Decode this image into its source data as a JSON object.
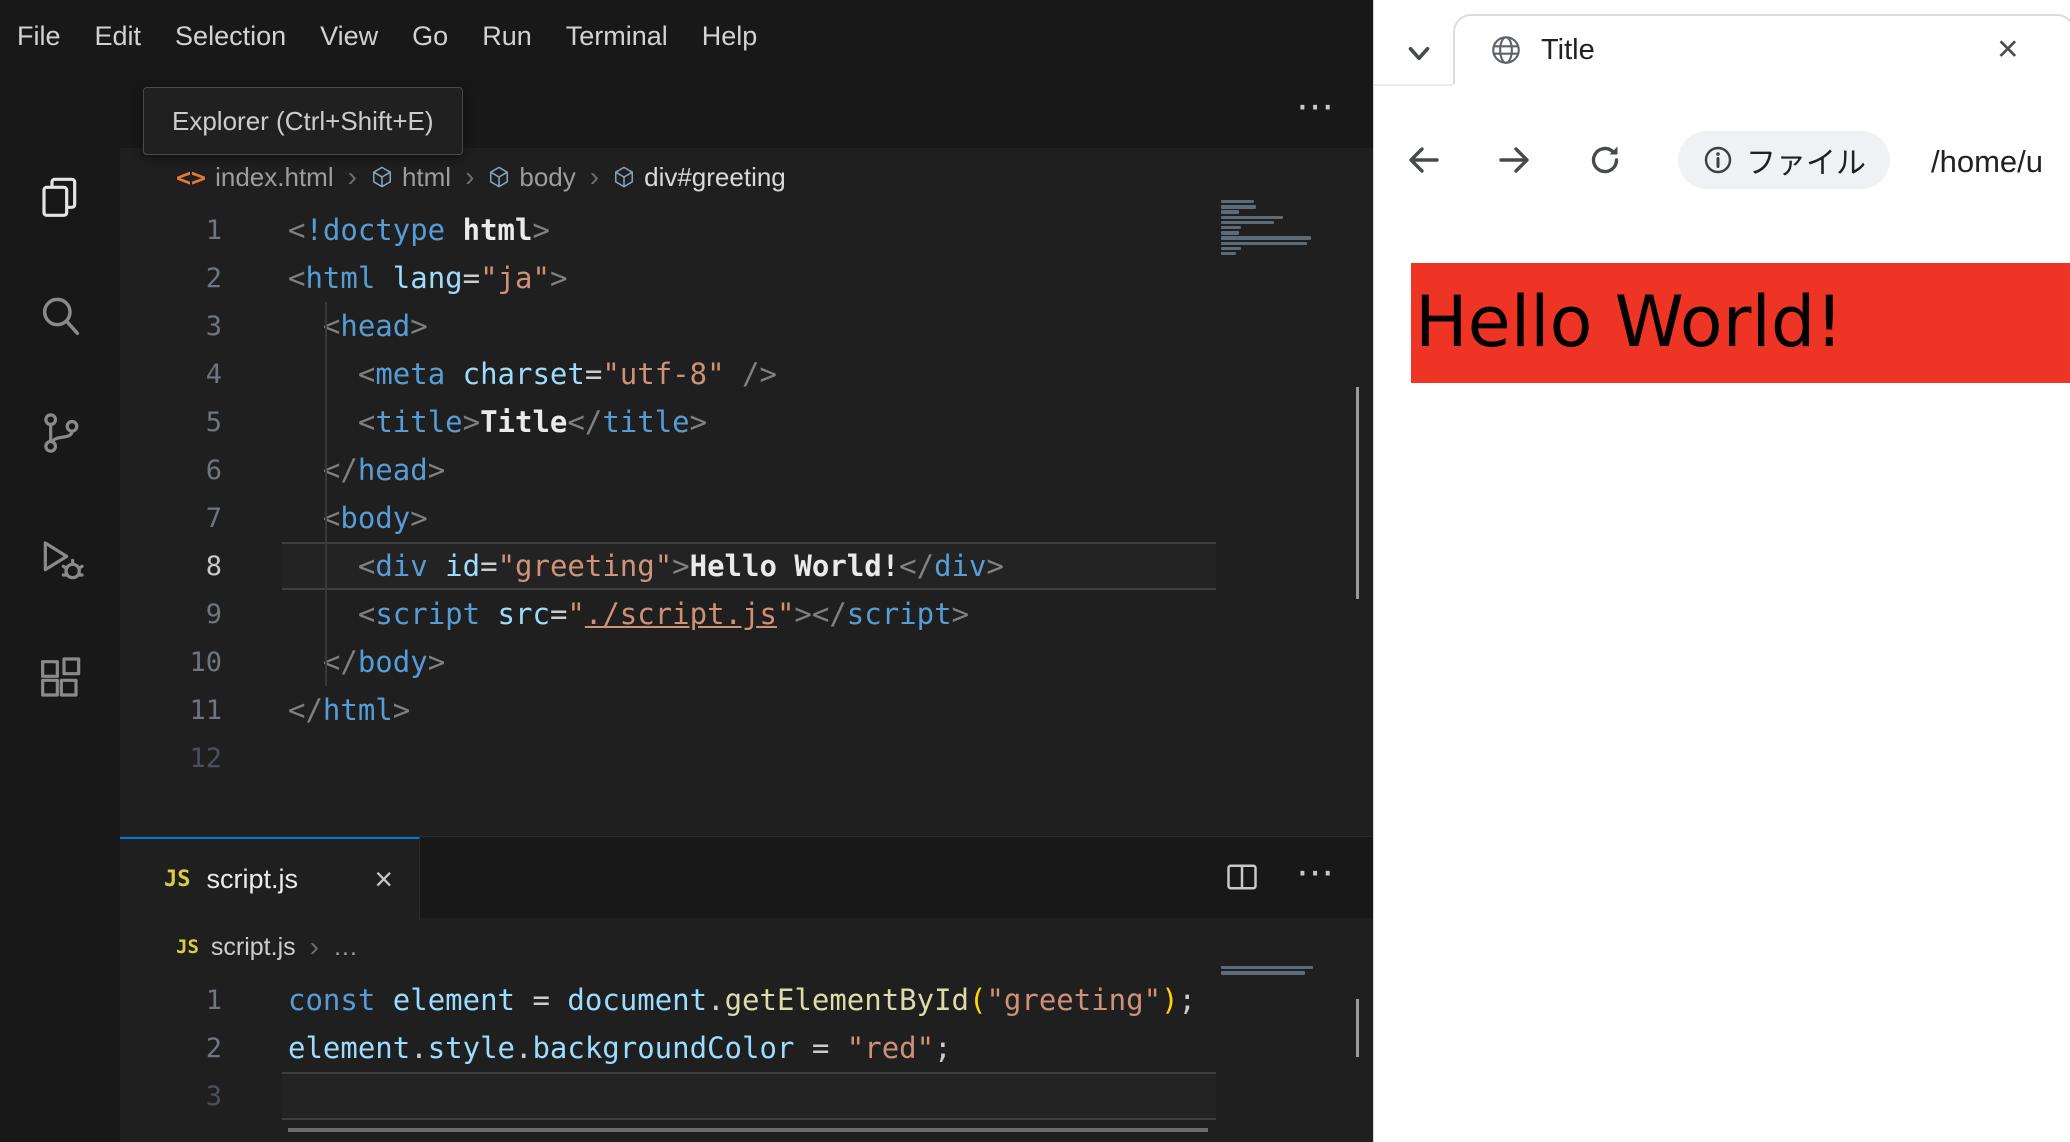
{
  "vscode": {
    "menu": [
      "File",
      "Edit",
      "Selection",
      "View",
      "Go",
      "Run",
      "Terminal",
      "Help"
    ],
    "tooltip": "Explorer (Ctrl+Shift+E)",
    "activity_icons": [
      "explorer",
      "search",
      "source-control",
      "run-debug",
      "extensions"
    ],
    "icons": {
      "html_file": "<>"
    },
    "more_glyph": "⋯",
    "breadcrumb": {
      "file": "index.html",
      "path": [
        "html",
        "body",
        "div#greeting"
      ],
      "separator": "›"
    },
    "editor_top": {
      "current_line": 8,
      "lines": [
        {
          "tokens": [
            [
              "<",
              "pun"
            ],
            [
              "!doctype",
              "tag"
            ],
            [
              " ",
              "txt"
            ],
            [
              "html",
              "txtb"
            ],
            [
              ">",
              "pun"
            ]
          ]
        },
        {
          "tokens": [
            [
              "<",
              "pun"
            ],
            [
              "html",
              "tag"
            ],
            [
              " ",
              "txt"
            ],
            [
              "lang",
              "attr"
            ],
            [
              "=",
              "txt"
            ],
            [
              "\"ja\"",
              "str"
            ],
            [
              ">",
              "pun"
            ]
          ]
        },
        {
          "tokens": [
            [
              "  ",
              "txt"
            ],
            [
              "<",
              "pun"
            ],
            [
              "head",
              "tag"
            ],
            [
              ">",
              "pun"
            ]
          ]
        },
        {
          "tokens": [
            [
              "    ",
              "txt"
            ],
            [
              "<",
              "pun"
            ],
            [
              "meta",
              "tag"
            ],
            [
              " ",
              "txt"
            ],
            [
              "charset",
              "attr"
            ],
            [
              "=",
              "txt"
            ],
            [
              "\"utf-8\"",
              "str"
            ],
            [
              " ",
              "txt"
            ],
            [
              "/>",
              "pun"
            ]
          ]
        },
        {
          "tokens": [
            [
              "    ",
              "txt"
            ],
            [
              "<",
              "pun"
            ],
            [
              "title",
              "tag"
            ],
            [
              ">",
              "pun"
            ],
            [
              "Title",
              "txtb"
            ],
            [
              "</",
              "pun"
            ],
            [
              "title",
              "tag"
            ],
            [
              ">",
              "pun"
            ]
          ]
        },
        {
          "tokens": [
            [
              "  ",
              "txt"
            ],
            [
              "</",
              "pun"
            ],
            [
              "head",
              "tag"
            ],
            [
              ">",
              "pun"
            ]
          ]
        },
        {
          "tokens": [
            [
              "  ",
              "txt"
            ],
            [
              "<",
              "pun"
            ],
            [
              "body",
              "tag"
            ],
            [
              ">",
              "pun"
            ]
          ]
        },
        {
          "tokens": [
            [
              "    ",
              "txt"
            ],
            [
              "<",
              "pun"
            ],
            [
              "div",
              "tag"
            ],
            [
              " ",
              "txt"
            ],
            [
              "id",
              "attr"
            ],
            [
              "=",
              "txt"
            ],
            [
              "\"greeting\"",
              "str"
            ],
            [
              ">",
              "pun"
            ],
            [
              "Hello World!",
              "txtb"
            ],
            [
              "</",
              "pun"
            ],
            [
              "div",
              "tag"
            ],
            [
              ">",
              "pun"
            ]
          ]
        },
        {
          "tokens": [
            [
              "    ",
              "txt"
            ],
            [
              "<",
              "pun"
            ],
            [
              "script",
              "tag"
            ],
            [
              " ",
              "txt"
            ],
            [
              "src",
              "attr"
            ],
            [
              "=",
              "txt"
            ],
            [
              "\"",
              "str"
            ],
            [
              "./script.js",
              "strlink"
            ],
            [
              "\"",
              "str"
            ],
            [
              ">",
              "pun"
            ],
            [
              "</",
              "pun"
            ],
            [
              "script",
              "tag"
            ],
            [
              ">",
              "pun"
            ]
          ]
        },
        {
          "tokens": [
            [
              "  ",
              "txt"
            ],
            [
              "</",
              "pun"
            ],
            [
              "body",
              "tag"
            ],
            [
              ">",
              "pun"
            ]
          ]
        },
        {
          "tokens": [
            [
              "</",
              "pun"
            ],
            [
              "html",
              "tag"
            ],
            [
              ">",
              "pun"
            ]
          ]
        },
        {
          "tokens": [],
          "dim": true
        }
      ]
    },
    "panel": {
      "tab_label": "script.js",
      "tab_icon": "JS",
      "close": "×",
      "breadcrumb_file": "script.js",
      "breadcrumb_more": "…",
      "breadcrumb_separator": "›"
    },
    "editor_bottom": {
      "current_line": 3,
      "lines": [
        {
          "tokens": [
            [
              "const",
              "kw"
            ],
            [
              " ",
              "txt"
            ],
            [
              "element",
              "var"
            ],
            [
              " ",
              "txt"
            ],
            [
              "=",
              "txt"
            ],
            [
              " ",
              "txt"
            ],
            [
              "document",
              "var"
            ],
            [
              ".",
              "txt"
            ],
            [
              "getElementById",
              "fn"
            ],
            [
              "(",
              "brk"
            ],
            [
              "\"greeting\"",
              "str"
            ],
            [
              ")",
              "brk"
            ],
            [
              ";",
              "txt"
            ]
          ]
        },
        {
          "tokens": [
            [
              "element",
              "var"
            ],
            [
              ".",
              "txt"
            ],
            [
              "style",
              "var"
            ],
            [
              ".",
              "txt"
            ],
            [
              "backgroundColor",
              "var"
            ],
            [
              " ",
              "txt"
            ],
            [
              "=",
              "txt"
            ],
            [
              " ",
              "txt"
            ],
            [
              "\"red\"",
              "str"
            ],
            [
              ";",
              "txt"
            ]
          ]
        },
        {
          "tokens": [],
          "dim": true
        }
      ]
    },
    "colors": {
      "accent": "#0078d4",
      "editor_bg": "#1f1f1f",
      "chrome_bg": "#181818"
    }
  },
  "browser": {
    "tab_title": "Title",
    "tab_close": "×",
    "address_chip": "ファイル",
    "address_path": "/home/u",
    "page": {
      "text": "Hello World!",
      "background": "#ee3424",
      "text_color": "#000000"
    }
  }
}
